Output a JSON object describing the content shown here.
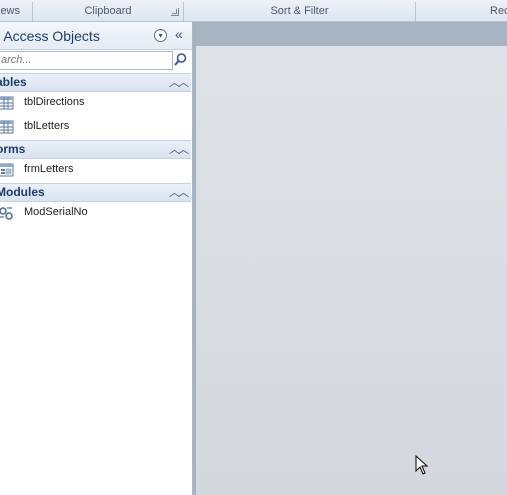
{
  "ribbon": {
    "groups": [
      "iews",
      "Clipboard",
      "Sort & Filter",
      "Rec"
    ]
  },
  "nav": {
    "title": "ll Access Objects",
    "search_placeholder": "arch...",
    "groups": [
      {
        "label": "ables",
        "items": [
          {
            "name": "tblDirections",
            "icon": "table-icon"
          },
          {
            "name": "tblLetters",
            "icon": "table-icon"
          }
        ]
      },
      {
        "label": "orms",
        "items": [
          {
            "name": "frmLetters",
            "icon": "form-icon"
          }
        ]
      },
      {
        "label": "Modules",
        "items": [
          {
            "name": "ModSerialNo",
            "icon": "module-icon"
          }
        ]
      }
    ]
  },
  "colors": {
    "accent": "#1f3c6e",
    "pane_border": "#a8b8cf",
    "workspace": "#d9dde3"
  }
}
